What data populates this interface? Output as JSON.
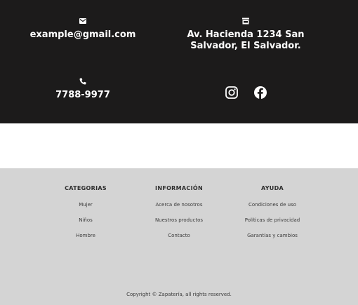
{
  "contact": {
    "email": "example@gmail.com",
    "address": "Av. Hacienda 1234 San Salvador, El Salvador.",
    "phone": "7788-9977",
    "icons": {
      "email": "mail-icon",
      "address": "store-icon",
      "phone": "phone-icon"
    }
  },
  "social": [
    {
      "name": "instagram-icon"
    },
    {
      "name": "facebook-icon"
    }
  ],
  "footer": {
    "columns": [
      {
        "title": "CATEGORIAS",
        "links": [
          "Mujer",
          "Niños",
          "Hombre"
        ]
      },
      {
        "title": "INFORMACIÓN",
        "links": [
          "Acerca de nosotros",
          "Nuestros productos",
          "Contacto"
        ]
      },
      {
        "title": "AYUDA",
        "links": [
          "Condiciones de uso",
          "Políticas de privacidad",
          "Garantías y cambios"
        ]
      }
    ],
    "copyright": "Copyright © Zapatería, all rights reserved."
  },
  "colors": {
    "band_background": "#1c1b1b",
    "footer_background": "#d4d4d4",
    "text_light": "#ffffff",
    "text_dark": "#3c3c3c"
  }
}
